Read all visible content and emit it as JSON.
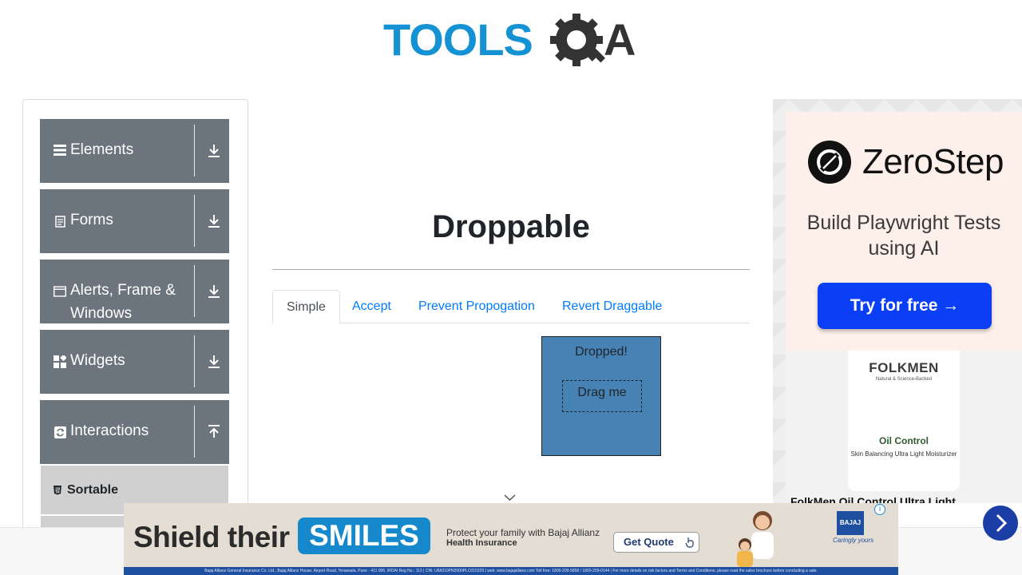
{
  "logo": {
    "text_blue": "TOOLS",
    "text_dark": "A",
    "brand_blue": "#1592d3",
    "brand_dark": "#333333"
  },
  "sidebar": {
    "groups": [
      {
        "label": "Elements",
        "icon": "list-icon",
        "expanded": false
      },
      {
        "label": "Forms",
        "icon": "form-icon",
        "expanded": false
      },
      {
        "label": "Alerts, Frame & Windows",
        "icon": "window-icon",
        "expanded": false
      },
      {
        "label": "Widgets",
        "icon": "widgets-icon",
        "expanded": false
      },
      {
        "label": "Interactions",
        "icon": "interactions-icon",
        "expanded": true
      }
    ],
    "items": [
      {
        "label": "Sortable",
        "icon": "sortable-icon"
      }
    ],
    "group_color": "#6c757d"
  },
  "main": {
    "title": "Droppable",
    "tabs": [
      {
        "label": "Simple",
        "active": true
      },
      {
        "label": "Accept",
        "active": false
      },
      {
        "label": "Prevent Propogation",
        "active": false
      },
      {
        "label": "Revert Draggable",
        "active": false
      }
    ],
    "drop_box": {
      "label": "Dropped!",
      "color": "#4682b4"
    },
    "drag_box": {
      "label": "Drag me"
    }
  },
  "ad_right": {
    "zerostep_name": "ZeroStep",
    "zerostep_tagline": "Build Playwright Tests using AI",
    "zerostep_button": "Try for free →",
    "product_brand": "FOLKMEN",
    "product_subtitle": "Natural & Science-Backed",
    "product_name": "Oil Control",
    "product_desc": "Skin Balancing Ultra Light Moisturizer",
    "product_title": "FolkMen Oil Control Ultra Light"
  },
  "banner": {
    "headline": "Shield their",
    "highlight": "SMILES",
    "protect_text": "Protect your family with Bajaj Allianz",
    "health_text": "Health Insurance",
    "cta": "Get Quote",
    "brand": "BAJAJ",
    "brand_tagline": "Caringly yours",
    "info": "i",
    "footer": "Bajaj Allianz General Insurance Co. Ltd., Bajaj Allianz House, Airport Road, Yerawada, Pune - 411 006. IRDAI Reg No.: 113 | CIN: U66010PN2000PLC015329 | web: www.bajajallianz.com Toll free: 1800-209-5858 / 1800-209-0144 | For more details on risk factors and Terms and Conditions, please read the sales brochure before concluding a sale."
  }
}
